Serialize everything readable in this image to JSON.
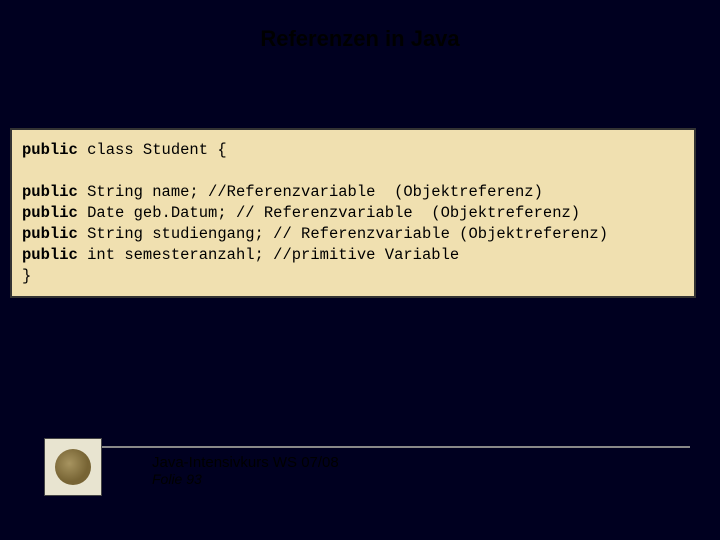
{
  "title": "Referenzen in Java",
  "code": {
    "kw": "public",
    "line1_rest": " class Student {",
    "blank": " ",
    "line2_rest": " String name; //Referenzvariable  (Objektreferenz)",
    "line3_rest": " Date geb.Datum; // Referenzvariable  (Objektreferenz)",
    "line4_rest": " String studiengang; // Referenzvariable (Objektreferenz)",
    "line5_rest": " int semesteranzahl; //primitive Variable",
    "close": "}"
  },
  "footer": {
    "course": "Java-Intensivkurs WS 07/08",
    "folie": "Folie 93"
  }
}
